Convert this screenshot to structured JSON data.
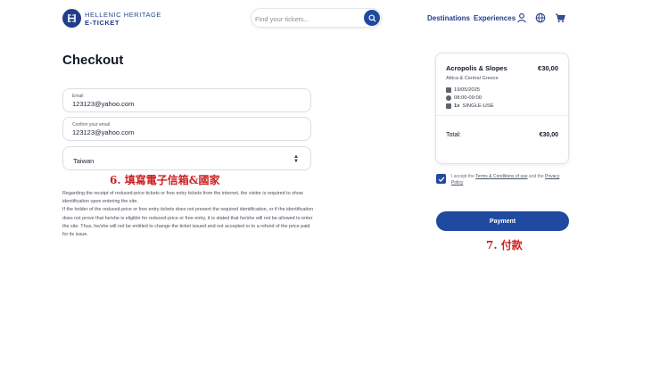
{
  "header": {
    "logo_line1": "HELLENIC HERITAGE",
    "logo_line2": "E-TICKET",
    "search_placeholder": "Find your tickets...",
    "nav": [
      "Destinations",
      "Experiences"
    ],
    "icons": [
      "user-icon",
      "globe-icon",
      "cart-icon"
    ],
    "brand_color": "#1f4aa0"
  },
  "checkout": {
    "title": "Checkout",
    "email_label": "Email",
    "email_value": "123123@yahoo.com",
    "confirm_label": "Confirm your email",
    "confirm_value": "123123@yahoo.com",
    "country_value": "Taiwan",
    "annotation_fields": "6. 填寫電子信箱&國家",
    "notice": [
      "Regarding the receipt of reduced-price tickets or free entry tickets from the internet, the visitor is required to show identification upon entering the site.",
      "If the holder of the reduced-price or free entry tickets does not present the required identification, or if the identification does not prove that he/she is eligible for reduced-price or free entry, it is stated that he/she will not be allowed to enter the site. Thus, he/she will not be entitled to change the ticket issued and not accepted or to a refund of the price paid for its issue."
    ]
  },
  "summary": {
    "name": "Acropolis & Slopes",
    "price": "€30,00",
    "region": "Attica & Central Greece",
    "date": "19/05/2025",
    "time": "08:00-09:00",
    "qty": "1x",
    "ticket_type": "SINGLE-USE",
    "total_label": "Total:",
    "total_value": "€30,00"
  },
  "terms": {
    "checked": true,
    "prefix": "I accept the",
    "link1": "Terms & Conditions of use",
    "mid": "and the",
    "link2": "Privacy Policy"
  },
  "payment": {
    "button_label": "Payment",
    "annotation": "7. 付款"
  }
}
